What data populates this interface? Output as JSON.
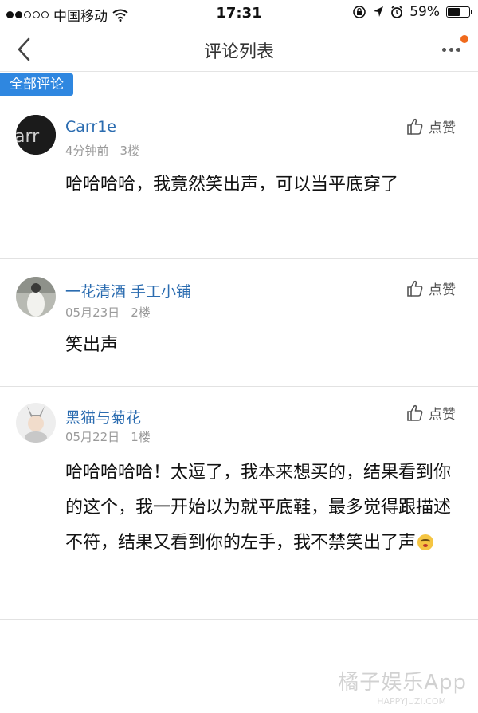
{
  "status_bar": {
    "carrier": "中国移动",
    "time": "17:31",
    "battery": "59%",
    "battery_level": 0.59
  },
  "nav": {
    "title": "评论列表"
  },
  "tab": {
    "label": "全部评论"
  },
  "like_label": "点赞",
  "comments": [
    {
      "username": "Carr1e",
      "time": "4分钟前",
      "floor": "3楼",
      "text": "哈哈哈哈，我竟然笑出声，可以当平底穿了"
    },
    {
      "username": "一花清酒 手工小铺",
      "time": "05月23日",
      "floor": "2楼",
      "text": "笑出声"
    },
    {
      "username": "黑猫与菊花",
      "time": "05月22日",
      "floor": "1楼",
      "text": "哈哈哈哈哈！太逗了，我本来想买的，结果看到你的这个，我一开始以为就平底鞋，最多觉得跟描述不符，结果又看到你的左手，我不禁笑出了声"
    }
  ],
  "watermark": {
    "text": "橘子娱乐App",
    "sub": "HAPPYJUZI.COM"
  }
}
